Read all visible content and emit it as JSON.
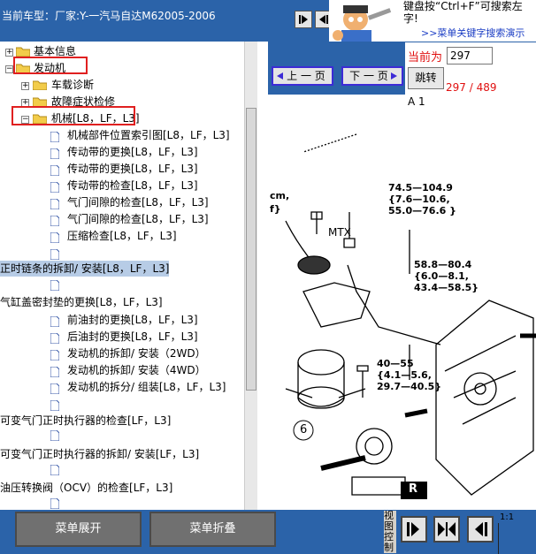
{
  "header": {
    "vehicle_label": "当前车型：厂家:Y-一汽马自达M62005-2006",
    "hint_line1": "键盘按“Ctrl+F”可搜索左",
    "hint_line2": "字!",
    "hint_link": ">>菜单关键字搜索演示"
  },
  "tree": {
    "n_basic": "基本信息",
    "n_engine": "发动机",
    "n_obd": "车载诊断",
    "n_trouble": "故障症状检修",
    "n_mech": "机械[L8，LF，L3]",
    "items": [
      "机械部件位置索引图[L8，LF，L3]",
      "传动带的更换[L8，LF，L3]",
      "传动带的更换[L8，LF，L3]",
      "传动带的检查[L8，LF，L3]",
      "气门间隙的检查[L8，LF，L3]",
      "气门间隙的检查[L8，LF，L3]",
      "压缩检查[L8，LF，L3]"
    ],
    "timing_chain": "正时链条的拆卸/ 安装[L8，LF，L3]",
    "head_gasket": "气缸盖密封垫的更换[L8，LF，L3]",
    "items2": [
      "前油封的更换[L8，LF，L3]",
      "后油封的更换[L8，LF，L3]",
      "发动机的拆卸/ 安装（2WD）",
      "发动机的拆卸/ 安装（4WD）",
      "发动机的拆分/ 组装[L8，LF，L3]"
    ],
    "vvt_check": "可变气门正时执行器的检查[LF，L3]",
    "vvt_remove": "可变气门正时执行器的拆卸/ 安装[LF，L3]",
    "ocv_check": "油压转换阀（OCV）的检查[LF，L3]"
  },
  "nav": {
    "prev_label": "上 一 页",
    "next_label": "下 一 页",
    "current_label": "当前为",
    "page_value": "297",
    "jump_label": "跳转",
    "page_count": "297 / 489",
    "section": "A 1"
  },
  "diagram": {
    "l1": "cm,",
    "l2": "f}",
    "mtx": "MTX",
    "t1": "74.5—104.9\n{7.6—10.6,\n55.0—76.6 }",
    "t2": "58.8—80.4\n{6.0—8.1,\n43.4—58.5}",
    "t3": "40—55\n{4.1—5.6,\n29.7—40.5}",
    "n6": "6",
    "r": "R"
  },
  "footer": {
    "expand_label": "菜单展开",
    "collapse_label": "菜单折叠",
    "view_control": "视图控制",
    "page_ratio": "1:1"
  },
  "colors": {
    "bar_blue": "#2b63a9",
    "highlight_red": "#e01010",
    "selection_blue": "#b7cce6"
  }
}
